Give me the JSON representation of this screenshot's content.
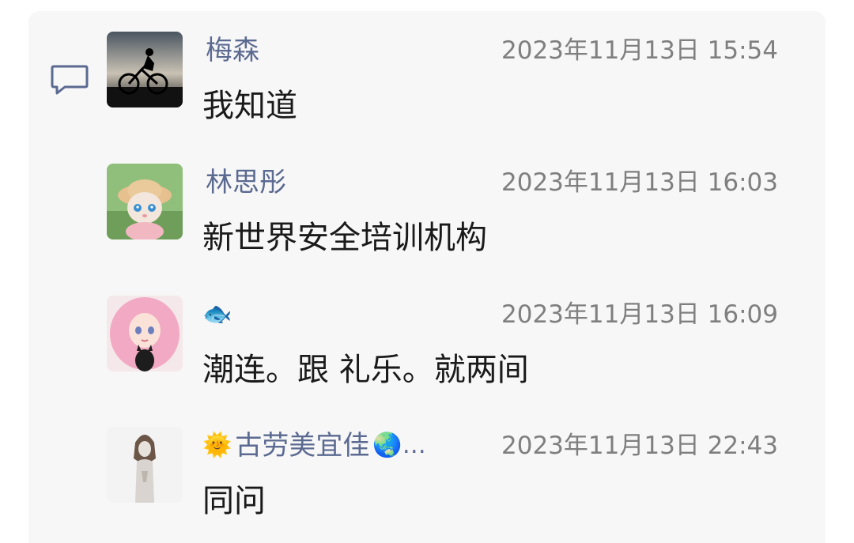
{
  "comments": [
    {
      "avatar": "cyclist-silhouette-avatar",
      "name_prefix_emoji": "",
      "name": "梅森",
      "name_suffix_emoji": "",
      "time": "2023年11月13日 15:54",
      "message": "我知道"
    },
    {
      "avatar": "cartoon-cat-avatar",
      "name_prefix_emoji": "",
      "name": "林思彤",
      "name_suffix_emoji": "",
      "time": "2023年11月13日 16:03",
      "message": "新世界安全培训机构"
    },
    {
      "avatar": "anime-girl-cat-avatar",
      "name_prefix_emoji": "🐟",
      "name": "",
      "name_suffix_emoji": "",
      "time": "2023年11月13日 16:09",
      "message": "潮连。跟 礼乐。就两间"
    },
    {
      "avatar": "statue-avatar",
      "name_prefix_emoji": "🌞",
      "name": "古劳美宜佳",
      "name_suffix_emoji": "🌏…",
      "time": "2023年11月13日 22:43",
      "message": "同问"
    }
  ],
  "icons": {
    "comment_icon": "speech-bubble-icon"
  },
  "colors": {
    "panel_bg": "#f7f7f7",
    "name_color": "#5b6a91",
    "time_color": "#7f7f7f",
    "message_color": "#1a1a1a"
  }
}
